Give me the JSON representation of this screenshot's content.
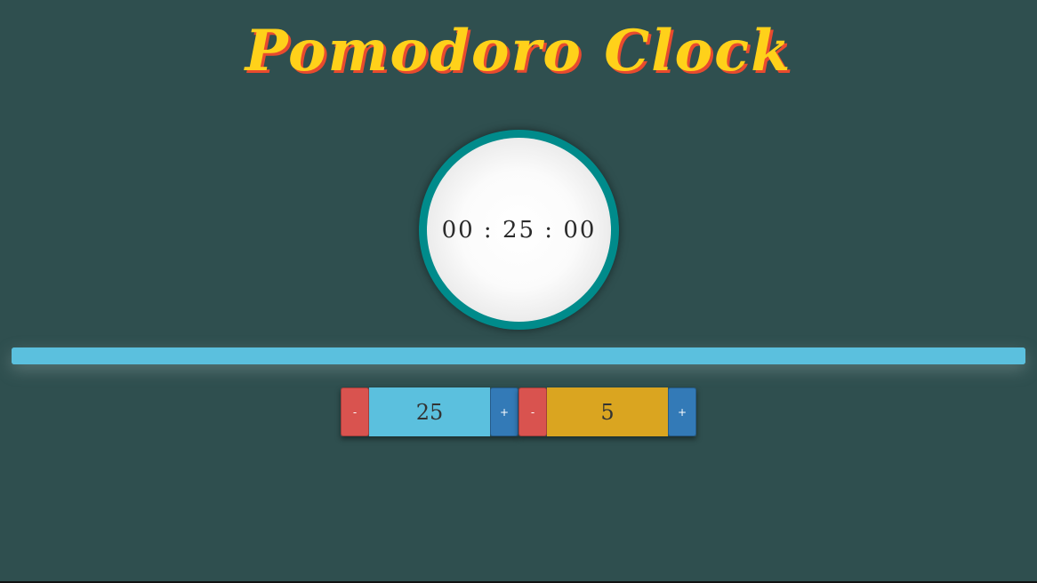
{
  "header": {
    "title": "Pomodoro Clock"
  },
  "clock": {
    "display": "00 : 25 : 00"
  },
  "progress": {
    "fraction": 1.0
  },
  "session": {
    "minus_label": "-",
    "value": "25",
    "plus_label": "+"
  },
  "break": {
    "minus_label": "-",
    "value": "5",
    "plus_label": "+"
  },
  "colors": {
    "background": "#2f4f4f",
    "title": "#ffd11a",
    "title_shadow": "#e84a2f",
    "ring": "#008b8b",
    "progress": "#5bc0de",
    "session": "#5bc0de",
    "break": "#daa520",
    "minus": "#d9534f",
    "plus": "#337ab7"
  }
}
